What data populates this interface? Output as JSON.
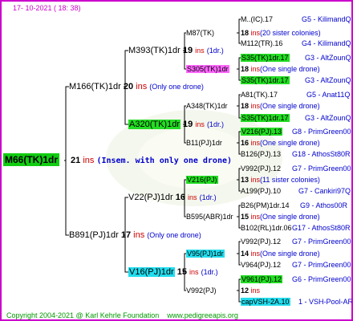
{
  "header": {
    "date": "17-  10-2021  ( 18:  38)"
  },
  "root": {
    "name": "M66(TK)1dr",
    "num": "21",
    "ins": "ins",
    "note": "(Insem. with only one drone)"
  },
  "gen1": [
    {
      "name": "M166(TK)1dr",
      "num": "20",
      "ins": "ins",
      "note": "(Only one drone)"
    },
    {
      "name": "B891(PJ)1dr",
      "num": "17",
      "ins": "ins",
      "note": "(Only one drone)"
    }
  ],
  "gen2": [
    {
      "name": "M393(TK)1dr",
      "num": "19",
      "ins": "ins",
      "note": "(1dr.)"
    },
    {
      "name": "A320(TK)1dr",
      "num": "19",
      "ins": "ins",
      "note": "(1dr.)"
    },
    {
      "name": "V22(PJ)1dr",
      "num": "16",
      "ins": "ins",
      "note": "(1dr.)"
    },
    {
      "name": "V16(PJ)1dr",
      "num": "15",
      "ins": "ins",
      "note": "(1dr.)"
    }
  ],
  "gen3": [
    {
      "name": "M87(TK)",
      "num": "18",
      "ins": "ins",
      "note": "(20 sister colonies)"
    },
    {
      "name": "S305(TK)1dr",
      "num": "18",
      "ins": "ins",
      "note": "(One single drone)"
    },
    {
      "name": "A348(TK)1dr",
      "num": "18",
      "ins": "ins",
      "note": "(One single drone)"
    },
    {
      "name": "B11(PJ)1dr",
      "num": "16",
      "ins": "ins",
      "note": "(One single drone)"
    },
    {
      "name": "V216(PJ)",
      "num": "13",
      "ins": "ins",
      "note": "(11 sister colonies)"
    },
    {
      "name": "B595(ABR)1dr",
      "num": "15",
      "ins": "ins",
      "note": "(One single drone)"
    },
    {
      "name": "V95(PJ)1dr",
      "num": "14",
      "ins": "ins",
      "note": "(One single drone)"
    },
    {
      "name": "V992(PJ)",
      "num": "12",
      "ins": "ins",
      "note": ""
    }
  ],
  "gen4": [
    {
      "name": "M..(IC).17",
      "code": "G5 - KilimandQ"
    },
    {
      "name": "M112(TR).16",
      "code": "G4 - KilimandQ"
    },
    {
      "name": "S35(TK)1dr.17",
      "code": "G3 - AltZounQ"
    },
    {
      "name": "S35(TK)1dr.17",
      "code": "G3 - AltZounQ"
    },
    {
      "name": "A81(TK).17",
      "code": "G5 - Anat11Q"
    },
    {
      "name": "S35(TK)1dr.17",
      "code": "G3 - AltZounQ"
    },
    {
      "name": "V216(PJ).13",
      "code": "G8 - PrimGreen00"
    },
    {
      "name": "B126(PJ).13",
      "code": "G18 - AthosSt80R"
    },
    {
      "name": "V992(PJ).12",
      "code": "G7 - PrimGreen00"
    },
    {
      "name": "A199(PJ).10",
      "code": "G7 - Cankiri97Q"
    },
    {
      "name": "B26(PM)1dr.14",
      "code": "G9 - Athos00R"
    },
    {
      "name": "B102(RL)1dr.06",
      "code": "G17 - AthosSt80R"
    },
    {
      "name": "V992(PJ).12",
      "code": "G7 - PrimGreen00"
    },
    {
      "name": "V964(PJ).12",
      "code": "G7 - PrimGreen00"
    },
    {
      "name": "V961(PJ).12",
      "code": "G6 - PrimGreen00"
    },
    {
      "name": "capVSH-2A.10",
      "code": "1 - VSH-Pool-AR"
    }
  ],
  "footer": {
    "copyright": "Copyright 2004-2021 @ Karl Kehrle Foundation",
    "site": "www.pedigreeapis.org"
  },
  "colors": {
    "frame": "#cc00cc",
    "green": "#22dd22",
    "magenta": "#ff66ff",
    "cyan": "#22ddee",
    "ins": "#cc0000",
    "note": "#0000cc"
  }
}
